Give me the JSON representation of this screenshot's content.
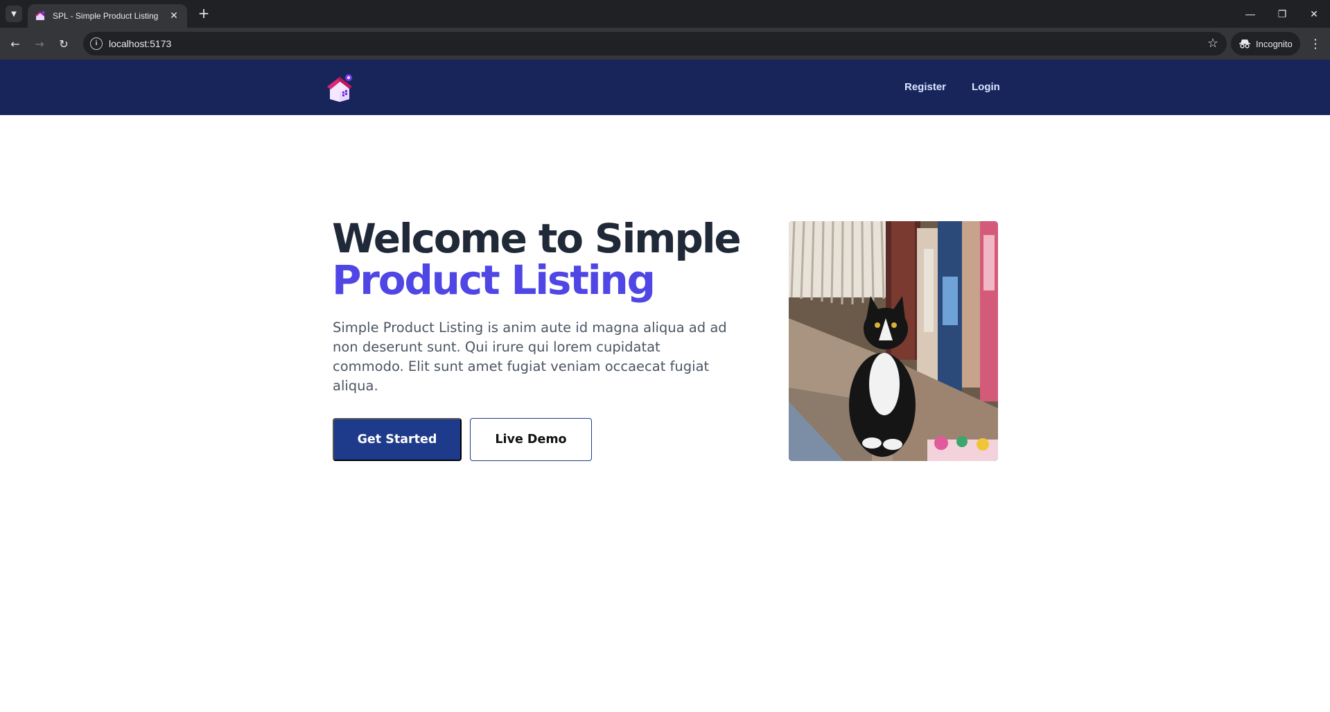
{
  "browser": {
    "tab_title": "SPL - Simple Product Listing",
    "url": "localhost:5173",
    "incognito_label": "Incognito"
  },
  "nav": {
    "links": [
      {
        "label": "Register"
      },
      {
        "label": "Login"
      }
    ]
  },
  "hero": {
    "title_line1": "Welcome to Simple",
    "title_line2": "Product Listing",
    "description": "Simple Product Listing is anim aute id magna aliqua ad ad non deserunt sunt. Qui irure qui lorem cupidatat commodo. Elit sunt amet fugiat veniam occaecat fugiat aliqua.",
    "primary_button": "Get Started",
    "secondary_button": "Live Demo"
  },
  "colors": {
    "nav_bg": "#18255b",
    "title_dark": "#1f2937",
    "title_accent": "#4f46e5",
    "primary_button": "#1e3a8a"
  },
  "icons": [
    "tab-search-icon",
    "favicon-house-icon",
    "tab-close-icon",
    "new-tab-icon",
    "minimize-icon",
    "restore-icon",
    "window-close-icon",
    "back-icon",
    "forward-icon",
    "reload-icon",
    "site-info-icon",
    "bookmark-star-icon",
    "incognito-icon",
    "browser-menu-icon",
    "site-logo-icon"
  ]
}
